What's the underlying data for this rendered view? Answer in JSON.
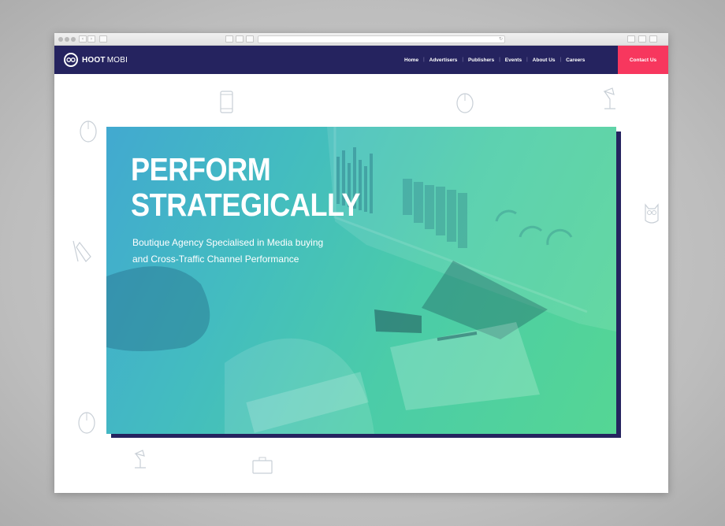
{
  "browser": {
    "nav_back": "‹",
    "nav_forward": "›",
    "refresh": "↻"
  },
  "site": {
    "logo_main": "HOOT",
    "logo_light": "MOBI",
    "nav": [
      {
        "label": "Home"
      },
      {
        "label": "Advertisers"
      },
      {
        "label": "Publishers"
      },
      {
        "label": "Events"
      },
      {
        "label": "About Us"
      },
      {
        "label": "Careers"
      }
    ],
    "separator": "|",
    "contact_label": "Contact Us"
  },
  "hero": {
    "title_line1": "PERFORM",
    "title_line2": "STRATEGICALLY",
    "subtitle_line1": "Boutique Agency Specialised in Media buying",
    "subtitle_line2": "and  Cross-Traffic Channel Performance"
  },
  "colors": {
    "nav_bg": "#25235f",
    "contact_bg": "#f7375e",
    "hero_gradient_start": "#42a9d0",
    "hero_gradient_end": "#55d694"
  },
  "icons": [
    "phone-icon",
    "mouse-icon",
    "desk-lamp-icon",
    "owl-icon",
    "pencil-ruler-icon",
    "briefcase-icon",
    "owl-logo-icon"
  ]
}
